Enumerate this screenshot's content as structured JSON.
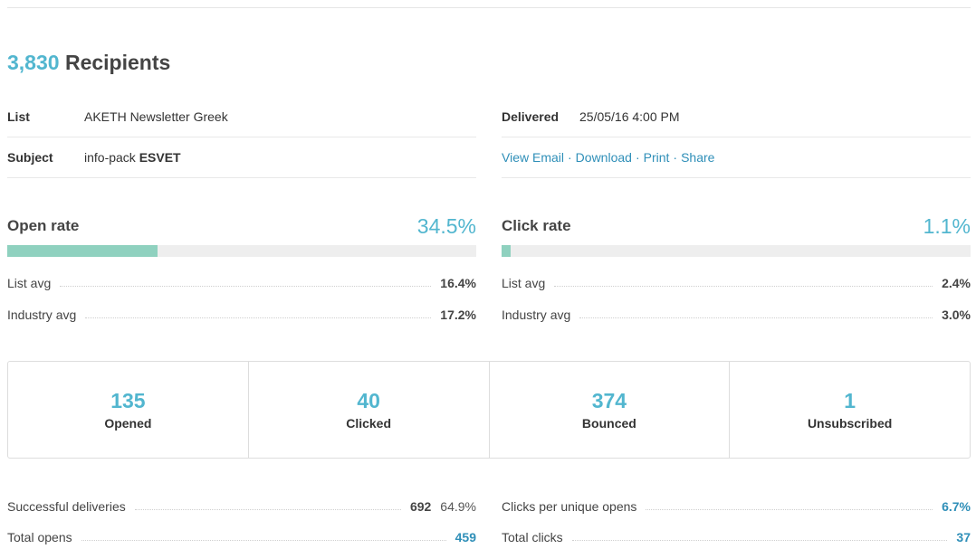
{
  "header": {
    "recipient_count": "3,830",
    "recipient_label": "Recipients"
  },
  "details": {
    "list_label": "List",
    "list_value": "AKETH Newsletter Greek",
    "subject_label": "Subject",
    "subject_value_prefix": "info-pack",
    "subject_value_bold": "ESVET",
    "delivered_label": "Delivered",
    "delivered_value": "25/05/16 4:00 PM",
    "links": [
      "View Email",
      "Download",
      "Print",
      "Share"
    ],
    "link_separator": "·"
  },
  "open_rate": {
    "title": "Open rate",
    "value": "34.5%",
    "fill_fraction": 0.32,
    "list_avg_label": "List avg",
    "list_avg_value": "16.4%",
    "industry_avg_label": "Industry avg",
    "industry_avg_value": "17.2%"
  },
  "click_rate": {
    "title": "Click rate",
    "value": "1.1%",
    "fill_fraction": 0.011,
    "list_avg_label": "List avg",
    "list_avg_value": "2.4%",
    "industry_avg_label": "Industry avg",
    "industry_avg_value": "3.0%"
  },
  "stats": [
    {
      "value": "135",
      "label": "Opened"
    },
    {
      "value": "40",
      "label": "Clicked"
    },
    {
      "value": "374",
      "label": "Bounced"
    },
    {
      "value": "1",
      "label": "Unsubscribed"
    }
  ],
  "summary": {
    "successful_deliveries_label": "Successful deliveries",
    "successful_deliveries_value": "692",
    "successful_deliveries_pct": "64.9%",
    "total_opens_label": "Total opens",
    "total_opens_value": "459",
    "clicks_per_unique_label": "Clicks per unique opens",
    "clicks_per_unique_value": "6.7%",
    "total_clicks_label": "Total clicks",
    "total_clicks_value": "37"
  },
  "colors": {
    "accent": "#52b6cf",
    "link": "#2f8fb8",
    "bar_fill": "#8fd1bf",
    "bar_track": "#eeeeee"
  }
}
